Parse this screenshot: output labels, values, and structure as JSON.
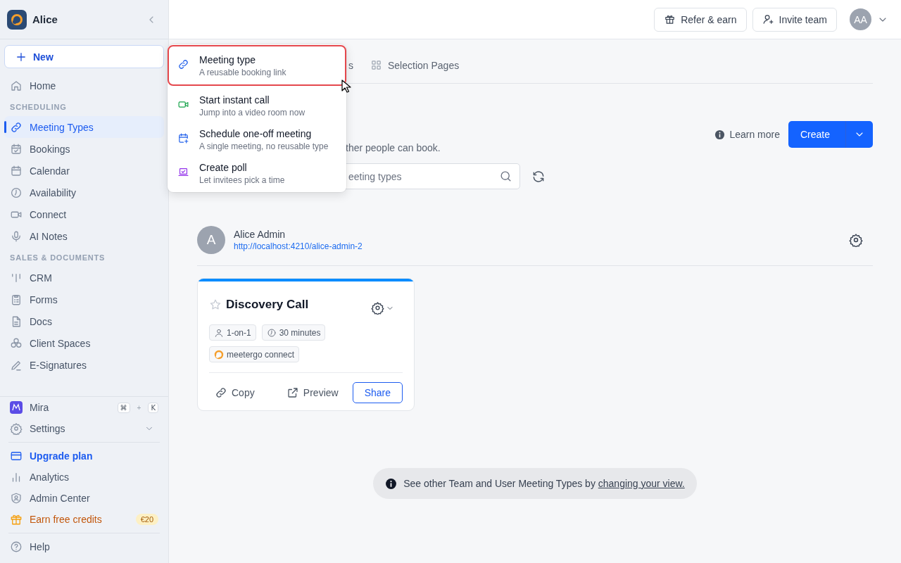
{
  "sidebar": {
    "brand": "Alice",
    "new_button": "New",
    "nav": [
      {
        "kind": "link",
        "label": "Home",
        "selected": false
      },
      {
        "kind": "section",
        "label": "SCHEDULING"
      },
      {
        "kind": "link",
        "label": "Meeting Types",
        "selected": true
      },
      {
        "kind": "link",
        "label": "Bookings",
        "selected": false
      },
      {
        "kind": "link",
        "label": "Calendar",
        "selected": false
      },
      {
        "kind": "link",
        "label": "Availability",
        "selected": false
      },
      {
        "kind": "link",
        "label": "Connect",
        "selected": false
      },
      {
        "kind": "link",
        "label": "AI Notes",
        "selected": false
      },
      {
        "kind": "section",
        "label": "SALES & DOCUMENTS"
      },
      {
        "kind": "link",
        "label": "CRM",
        "selected": false
      },
      {
        "kind": "link",
        "label": "Forms",
        "selected": false
      },
      {
        "kind": "link",
        "label": "Docs",
        "selected": false
      },
      {
        "kind": "link",
        "label": "Client Spaces",
        "selected": false
      },
      {
        "kind": "link",
        "label": "E-Signatures",
        "selected": false
      }
    ],
    "bottom": [
      {
        "kind": "assistant",
        "label": "Mira",
        "keys": [
          "⌘",
          "+",
          "K"
        ]
      },
      {
        "kind": "expander",
        "label": "Settings",
        "expanded": false
      },
      {
        "kind": "divider"
      },
      {
        "kind": "upgrade",
        "label": "Upgrade plan"
      },
      {
        "kind": "link",
        "label": "Analytics"
      },
      {
        "kind": "link",
        "label": "Admin Center"
      },
      {
        "kind": "credits",
        "label": "Earn free credits",
        "badge": "€20"
      },
      {
        "kind": "divider"
      },
      {
        "kind": "link",
        "label": "Help"
      }
    ]
  },
  "topbar": {
    "buttons": [
      "Refer & earn",
      "Invite team"
    ],
    "avatar": "AA"
  },
  "tabs": [
    {
      "label": "s",
      "selected": false
    },
    {
      "label": "Selection Pages",
      "selected": false
    }
  ],
  "description": "ther people can book.",
  "learn_more": "Learn more",
  "create_button": "Create",
  "search": {
    "placeholder": "eeting types"
  },
  "owner": {
    "initial": "A",
    "name": "Alice Admin",
    "url": "http://localhost:4210/alice-admin-2"
  },
  "cards": [
    {
      "title": "Discovery Call",
      "starred": false,
      "color": "#0a8cff",
      "tags": [
        {
          "kind": "type",
          "label": "1-on-1"
        },
        {
          "kind": "duration",
          "label": "30 minutes"
        },
        {
          "kind": "location",
          "label": "meetergo connect"
        }
      ],
      "actions": [
        "Copy",
        "Preview",
        "Share"
      ]
    }
  ],
  "notice": {
    "text": "See other Team and User Meeting Types by ",
    "link": "changing your view."
  },
  "menu": [
    {
      "title": "Meeting type",
      "subtitle": "A reusable booking link",
      "selected": true
    },
    {
      "title": "Start instant call",
      "subtitle": "Jump into a video room now",
      "selected": false
    },
    {
      "title": "Schedule one-off meeting",
      "subtitle": "A single meeting, no reusable type",
      "selected": false
    },
    {
      "title": "Create poll",
      "subtitle": "Let invitees pick a time",
      "selected": false
    }
  ]
}
